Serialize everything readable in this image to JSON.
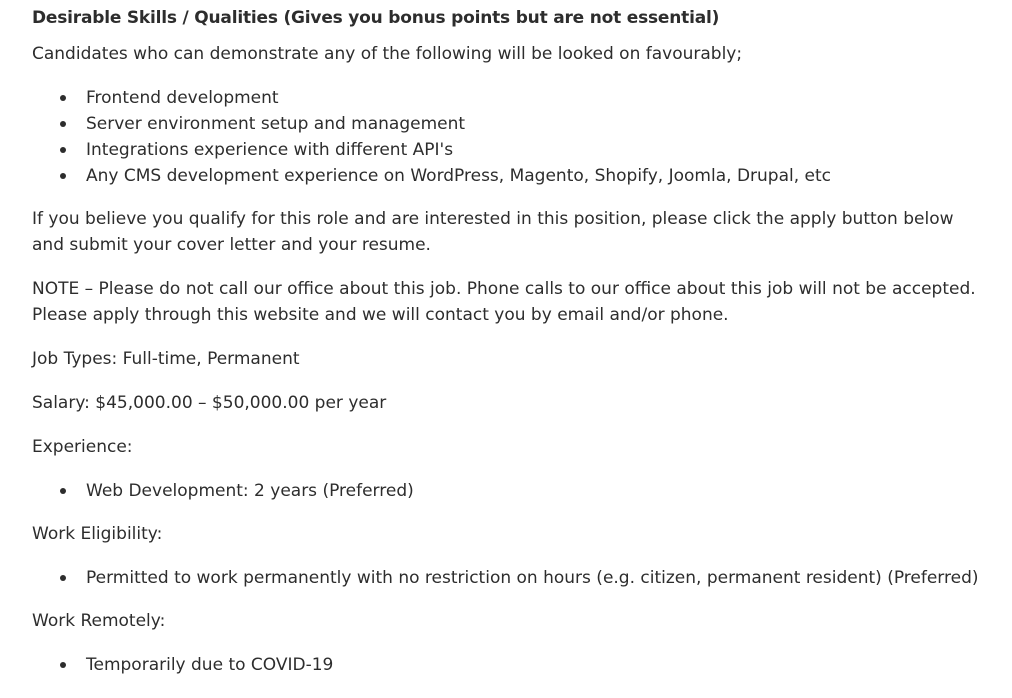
{
  "job_description": {
    "desirable_heading": "Desirable Skills / Qualities (Gives you bonus points but are not essential)",
    "intro": "Candidates who can demonstrate any of the following will be looked on favourably;",
    "desirable_items": [
      "Frontend development",
      "Server environment setup and management",
      "Integrations experience with different API's",
      "Any CMS development experience on WordPress, Magento, Shopify, Joomla, Drupal, etc"
    ],
    "apply_instructions": "If you believe you qualify for this role and are interested in this position, please click the apply button below and submit your cover letter and your resume.",
    "note": "NOTE – Please do not call our office about this job. Phone calls to our office about this job will not be accepted. Please apply through this website and we will contact you by email and/or phone.",
    "job_types": "Job Types: Full-time, Permanent",
    "salary": "Salary: $45,000.00 – $50,000.00 per year",
    "experience_label": "Experience:",
    "experience_items": [
      "Web Development: 2 years (Preferred)"
    ],
    "work_eligibility_label": "Work Eligibility:",
    "work_eligibility_items": [
      "Permitted to work permanently with no restriction on hours (e.g. citizen, permanent resident) (Preferred)"
    ],
    "work_remotely_label": "Work Remotely:",
    "work_remotely_items": [
      "Temporarily due to COVID-19"
    ]
  }
}
